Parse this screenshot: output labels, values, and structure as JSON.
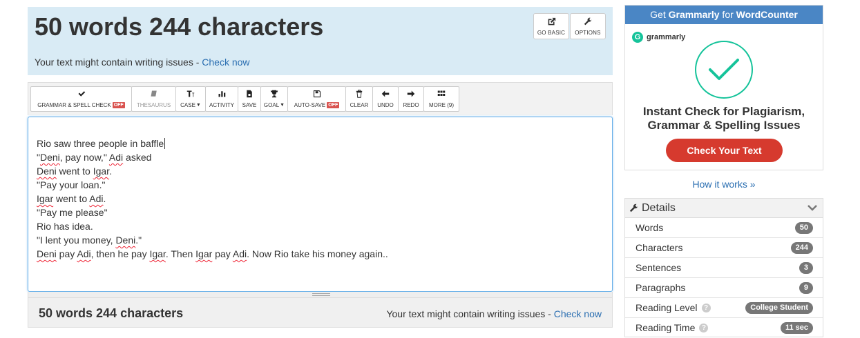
{
  "header": {
    "counts": "50 words 244 characters",
    "issues_text": "Your text might contain writing issues - ",
    "check_now": "Check now",
    "go_basic": "GO BASIC",
    "options": "OPTIONS"
  },
  "toolbar": {
    "grammar": "GRAMMAR & SPELL CHECK",
    "off": "OFF",
    "thesaurus": "THESAURUS",
    "case": "CASE",
    "activity": "ACTIVITY",
    "save": "SAVE",
    "goal": "GOAL",
    "autosave": "AUTO-SAVE",
    "clear": "CLEAR",
    "undo": "UNDO",
    "redo": "REDO",
    "more": "MORE (9)"
  },
  "editor": {
    "l1": "Rio saw three people in baffle",
    "l2a": "\"",
    "l2b": "Deni",
    "l2c": ", pay now,\" ",
    "l2d": "Adi",
    "l2e": " asked",
    "l3a": "Deni",
    "l3b": " went to ",
    "l3c": "Igar",
    "l3d": ".",
    "l4": "\"Pay your loan.\"",
    "l5a": "Igar",
    "l5b": " went to ",
    "l5c": "Adi",
    "l5d": ".",
    "l6": "\"Pay me please\"",
    "l7": "Rio has idea.",
    "l8a": "\"I lent you money, ",
    "l8b": "Deni",
    "l8c": ".\"",
    "l9a": "Deni",
    "l9b": " pay ",
    "l9c": "Adi",
    "l9d": ", then he pay ",
    "l9e": "Igar",
    "l9f": ". Then ",
    "l9g": "Igar",
    "l9h": " pay ",
    "l9i": "Adi",
    "l9j": ". Now Rio take his money again.."
  },
  "bottom": {
    "counts": "50 words 244 characters",
    "issues_text": "Your text might contain writing issues - ",
    "check_now": "Check now"
  },
  "ad": {
    "head_pre": "Get ",
    "head_brand": "Grammarly",
    "head_mid": " for ",
    "head_site": "WordCounter",
    "logo_text": "grammarly",
    "line1": "Instant Check for Plagiarism,",
    "line2": "Grammar & Spelling Issues",
    "button": "Check Your Text",
    "how": "How it works »"
  },
  "details": {
    "title": "Details",
    "rows": [
      {
        "label": "Words",
        "value": "50"
      },
      {
        "label": "Characters",
        "value": "244"
      },
      {
        "label": "Sentences",
        "value": "3"
      },
      {
        "label": "Paragraphs",
        "value": "9"
      },
      {
        "label": "Reading Level",
        "value": "College Student"
      },
      {
        "label": "Reading Time",
        "value": "11 sec"
      }
    ]
  },
  "colors": {
    "accent": "#2a6eb1",
    "header_bg": "#d9ebf5",
    "off_badge": "#d9534f",
    "grammarly_green": "#15c39a",
    "ad_button": "#d63a2e"
  }
}
